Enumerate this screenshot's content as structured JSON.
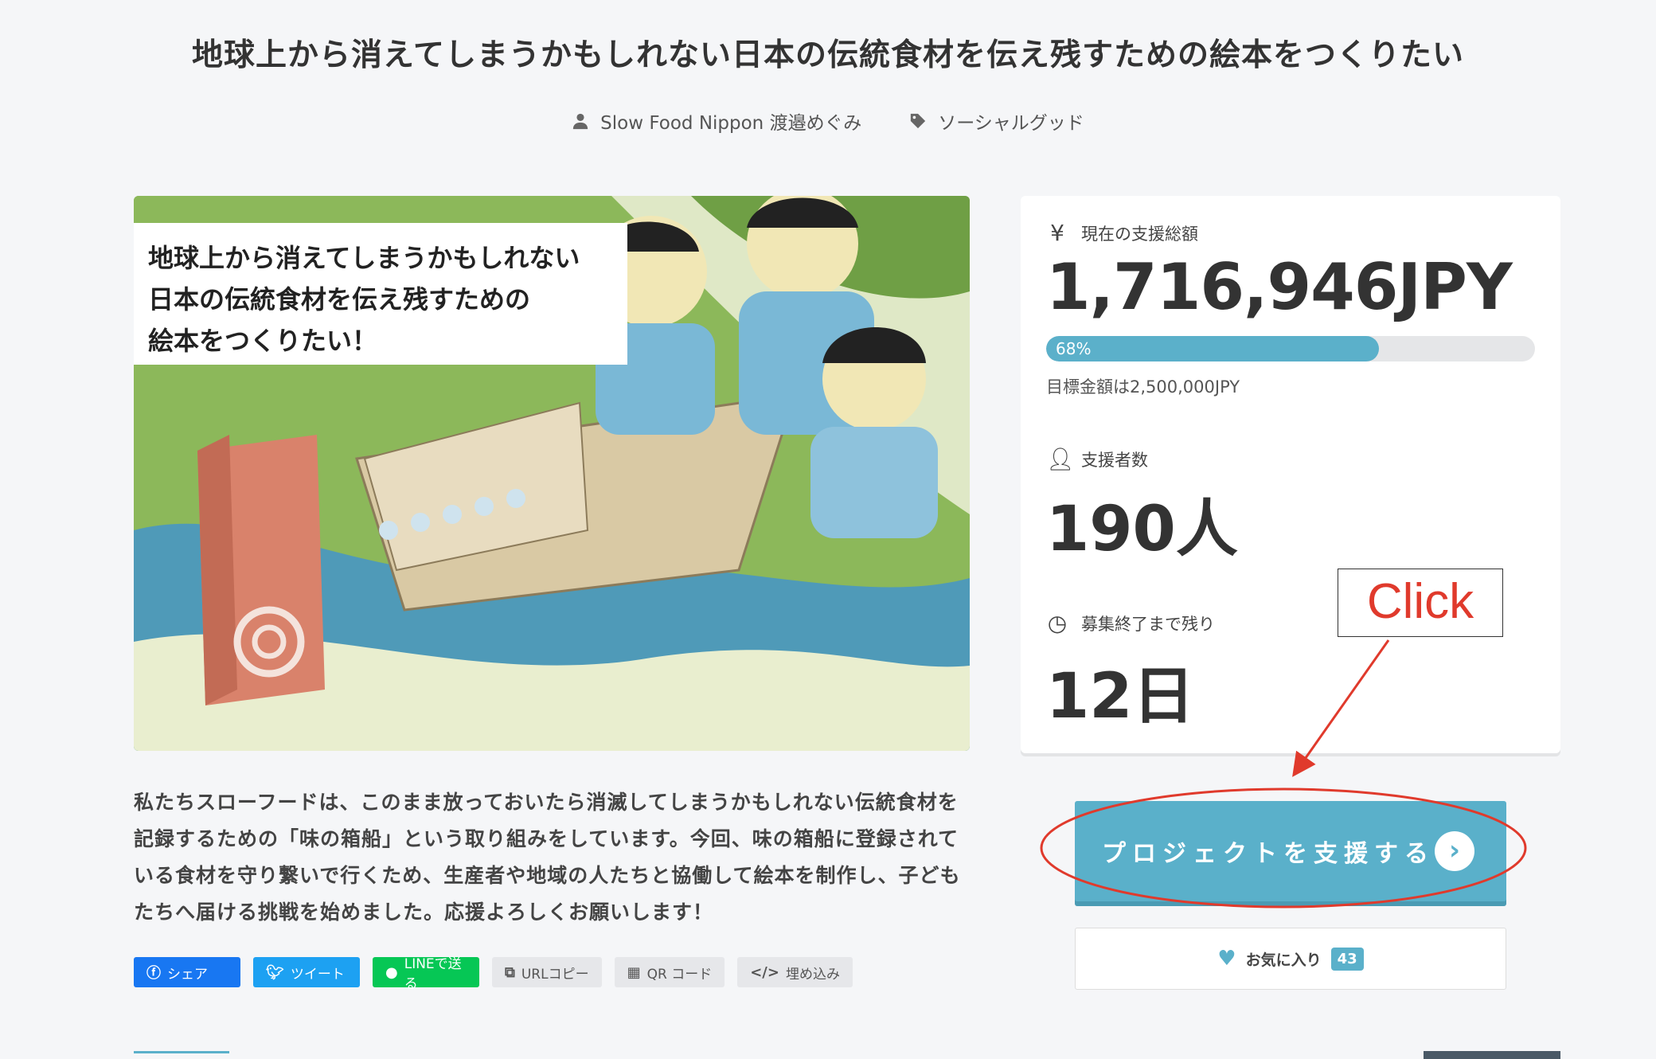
{
  "project": {
    "title": "地球上から消えてしまうかもしれない日本の伝統食材を伝え残すための絵本をつくりたい",
    "author": "Slow Food Nippon 渡邉めぐみ",
    "category": "ソーシャルグッド",
    "image_text_lines": [
      "地球上から消えてしまうかもしれない",
      "日本の伝統食材を伝え残すための",
      "絵本をつくりたい！"
    ],
    "description": "私たちスローフードは、このまま放っておいたら消滅してしまうかもしれない伝統食材を記録するための「味の箱船」という取り組みをしています。今回、味の箱船に登録されている食材を守り繋いで行くため、生産者や地域の人たちと協働して絵本を制作し、子どもたちへ届ける挑戦を始めました。応援よろしくお願いします！"
  },
  "share": {
    "facebook": "シェア",
    "twitter": "ツイート",
    "line": "LINEで送る",
    "url_copy": "URLコピー",
    "qr": "QR コード",
    "embed": "埋め込み"
  },
  "stats": {
    "amount_label": "現在の支援総額",
    "amount": "1,716,946JPY",
    "progress_text": "68%",
    "progress_fraction": 0.68,
    "goal": "目標金額は2,500,000JPY",
    "backers_label": "支援者数",
    "backers": "190人",
    "remaining_label": "募集終了まで残り",
    "remaining": "12日"
  },
  "annotation": {
    "callout": "Click",
    "color": "#e03a2c"
  },
  "actions": {
    "support": "プロジェクトを支援する",
    "favorite": "お気に入り",
    "favorite_count": "43"
  }
}
